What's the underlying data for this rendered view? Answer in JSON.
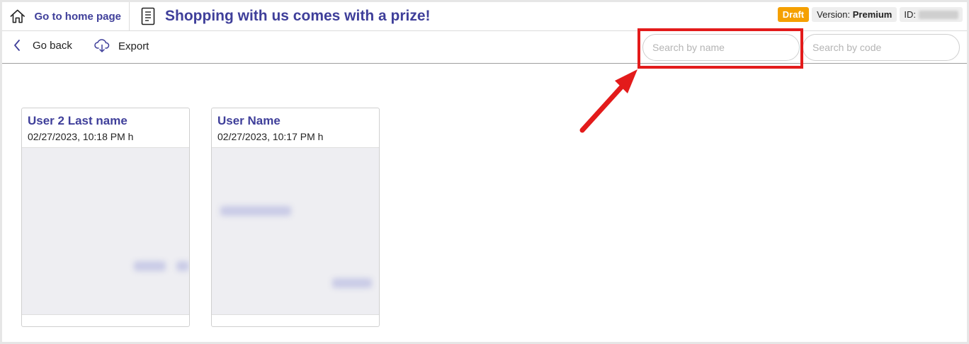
{
  "header": {
    "home_label": "Go to home page",
    "title": "Shopping with us comes with a prize!",
    "status_badge": "Draft",
    "version_prefix": "Version: ",
    "version_value": "Premium",
    "id_label": "ID:"
  },
  "toolbar": {
    "back_label": "Go back",
    "export_label": "Export",
    "search_name_placeholder": "Search by name",
    "search_code_placeholder": "Search by code"
  },
  "cards": [
    {
      "name": "User 2 Last name",
      "date": "02/27/2023, 10:18 PM h"
    },
    {
      "name": "User Name",
      "date": "02/27/2023, 10:17 PM h"
    }
  ],
  "icons": {
    "home": "home-icon",
    "document": "document-icon",
    "back": "chevron-left-icon",
    "export": "cloud-download-icon"
  },
  "colors": {
    "brand": "#3f3f9a",
    "draft": "#f5a000",
    "highlight": "#e31b1b"
  }
}
